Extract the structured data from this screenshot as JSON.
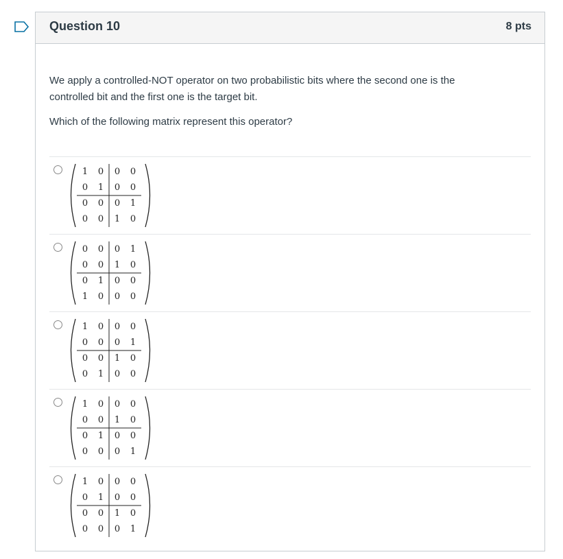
{
  "question": {
    "title": "Question 10",
    "points": "8 pts",
    "text": "We apply a controlled-NOT operator on two probabilistic bits where the second one is the controlled bit and the first one is the target bit.",
    "prompt": "Which of the following matrix represent this operator?"
  },
  "answers": [
    {
      "matrix": [
        [
          "1",
          "0",
          "0",
          "0"
        ],
        [
          "0",
          "1",
          "0",
          "0"
        ],
        [
          "0",
          "0",
          "0",
          "1"
        ],
        [
          "0",
          "0",
          "1",
          "0"
        ]
      ]
    },
    {
      "matrix": [
        [
          "0",
          "0",
          "0",
          "1"
        ],
        [
          "0",
          "0",
          "1",
          "0"
        ],
        [
          "0",
          "1",
          "0",
          "0"
        ],
        [
          "1",
          "0",
          "0",
          "0"
        ]
      ]
    },
    {
      "matrix": [
        [
          "1",
          "0",
          "0",
          "0"
        ],
        [
          "0",
          "0",
          "0",
          "1"
        ],
        [
          "0",
          "0",
          "1",
          "0"
        ],
        [
          "0",
          "1",
          "0",
          "0"
        ]
      ]
    },
    {
      "matrix": [
        [
          "1",
          "0",
          "0",
          "0"
        ],
        [
          "0",
          "0",
          "1",
          "0"
        ],
        [
          "0",
          "1",
          "0",
          "0"
        ],
        [
          "0",
          "0",
          "0",
          "1"
        ]
      ]
    },
    {
      "matrix": [
        [
          "1",
          "0",
          "0",
          "0"
        ],
        [
          "0",
          "1",
          "0",
          "0"
        ],
        [
          "0",
          "0",
          "1",
          "0"
        ],
        [
          "0",
          "0",
          "0",
          "1"
        ]
      ]
    }
  ],
  "colors": {
    "flag": "#0770a3",
    "border": "#c7cdd1",
    "header_bg": "#f5f5f5"
  }
}
